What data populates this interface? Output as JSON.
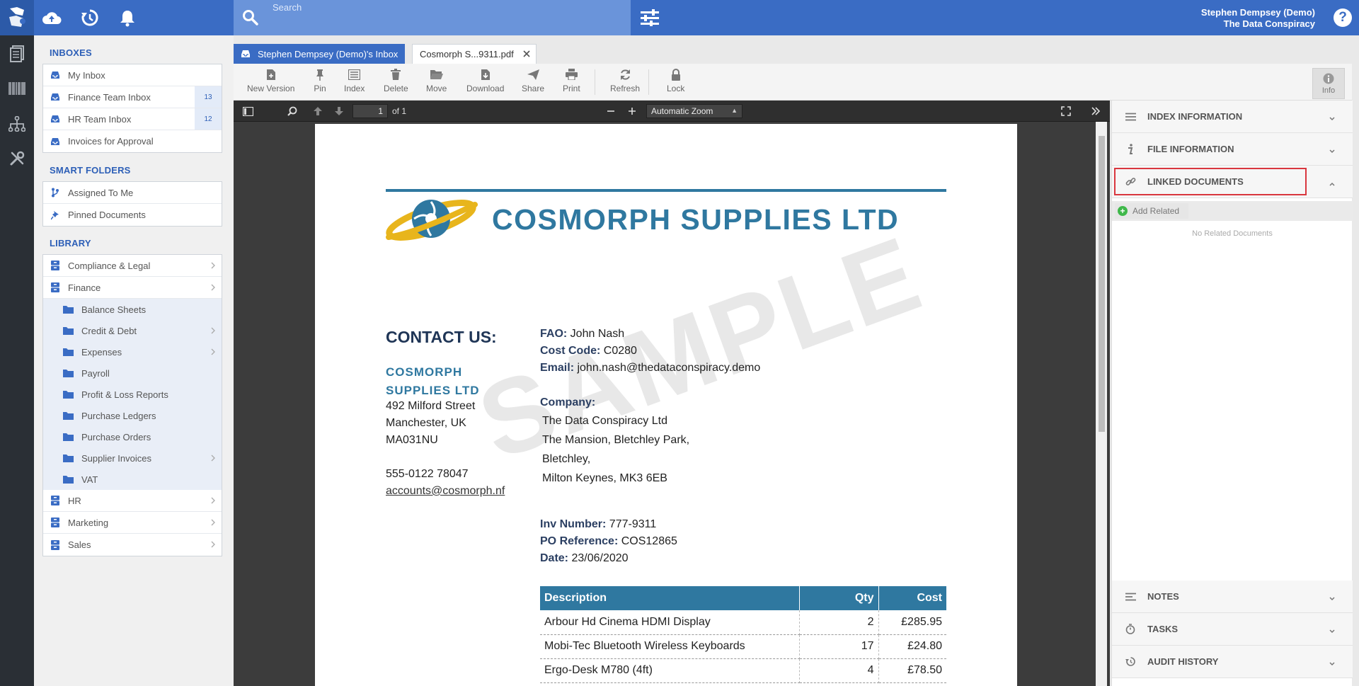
{
  "topbar": {
    "search_placeholder": "Search",
    "user_name": "Stephen Dempsey (Demo)",
    "org_name": "The Data Conspiracy",
    "help_label": "?"
  },
  "sidebar": {
    "inboxes_title": "INBOXES",
    "inboxes": [
      {
        "label": "My Inbox",
        "badge": ""
      },
      {
        "label": "Finance Team Inbox",
        "badge": "13"
      },
      {
        "label": "HR Team Inbox",
        "badge": "12"
      },
      {
        "label": "Invoices for Approval",
        "badge": ""
      }
    ],
    "smart_title": "SMART FOLDERS",
    "smart": [
      {
        "label": "Assigned To Me"
      },
      {
        "label": "Pinned Documents"
      }
    ],
    "library_title": "LIBRARY",
    "library": [
      {
        "label": "Compliance & Legal"
      },
      {
        "label": "Finance"
      },
      {
        "label": "HR"
      },
      {
        "label": "Marketing"
      },
      {
        "label": "Sales"
      }
    ],
    "finance_children": [
      {
        "label": "Balance Sheets"
      },
      {
        "label": "Credit & Debt"
      },
      {
        "label": "Expenses"
      },
      {
        "label": "Payroll"
      },
      {
        "label": "Profit & Loss Reports"
      },
      {
        "label": "Purchase Ledgers"
      },
      {
        "label": "Purchase Orders"
      },
      {
        "label": "Supplier Invoices"
      },
      {
        "label": "VAT"
      }
    ]
  },
  "tabs": {
    "inbox_tab": "Stephen Dempsey (Demo)'s Inbox",
    "doc_tab": "Cosmorph S...9311.pdf"
  },
  "toolbar": {
    "new_version": "New Version",
    "pin": "Pin",
    "index": "Index",
    "delete": "Delete",
    "move": "Move",
    "download": "Download",
    "share": "Share",
    "print": "Print",
    "refresh": "Refresh",
    "lock": "Lock",
    "info": "Info"
  },
  "viewer": {
    "page_number": "1",
    "page_of": "of 1",
    "zoom": "Automatic Zoom"
  },
  "document": {
    "company_title": "COSMORPH SUPPLIES LTD",
    "watermark": "SAMPLE",
    "contact_heading": "CONTACT US:",
    "cos_name_1": "COSMORPH",
    "cos_name_2": "SUPPLIES LTD",
    "address_1": "492 Milford Street",
    "address_2": "Manchester, UK",
    "address_3": "MA031NU",
    "phone": "555-0122 78047",
    "email_link": "accounts@cosmorph.nf",
    "fao_label": "FAO:",
    "fao_value": "John Nash",
    "cost_label": "Cost Code:",
    "cost_value": "C0280",
    "email_label": "Email:",
    "email_value": "john.nash@thedataconspiracy.demo",
    "company_label": "Company:",
    "company_1": "The Data Conspiracy Ltd",
    "company_2": "The Mansion, Bletchley Park,",
    "company_3": "Bletchley,",
    "company_4": "Milton Keynes, MK3 6EB",
    "inv_label": "Inv Number:",
    "inv_value": "777-9311",
    "po_label": "PO Reference:",
    "po_value": "COS12865",
    "date_label": "Date:",
    "date_value": "23/06/2020",
    "table_headers": {
      "description": "Description",
      "qty": "Qty",
      "cost": "Cost"
    },
    "rows": [
      {
        "description": "Arbour Hd Cinema HDMI Display",
        "qty": "2",
        "cost": "£285.95"
      },
      {
        "description": "Mobi-Tec Bluetooth Wireless Keyboards",
        "qty": "17",
        "cost": "£24.80"
      },
      {
        "description": "Ergo-Desk M780 (4ft)",
        "qty": "4",
        "cost": "£78.50"
      }
    ]
  },
  "right_panel": {
    "index_info": "INDEX INFORMATION",
    "file_info": "FILE INFORMATION",
    "linked_docs": "LINKED DOCUMENTS",
    "add_related": "Add Related",
    "no_related": "No Related Documents",
    "notes": "NOTES",
    "tasks": "TASKS",
    "audit": "AUDIT HISTORY"
  },
  "colors": {
    "brand_blue": "#3a6cc4",
    "doc_blue": "#2f78a0",
    "highlight_red": "#d9363e"
  }
}
